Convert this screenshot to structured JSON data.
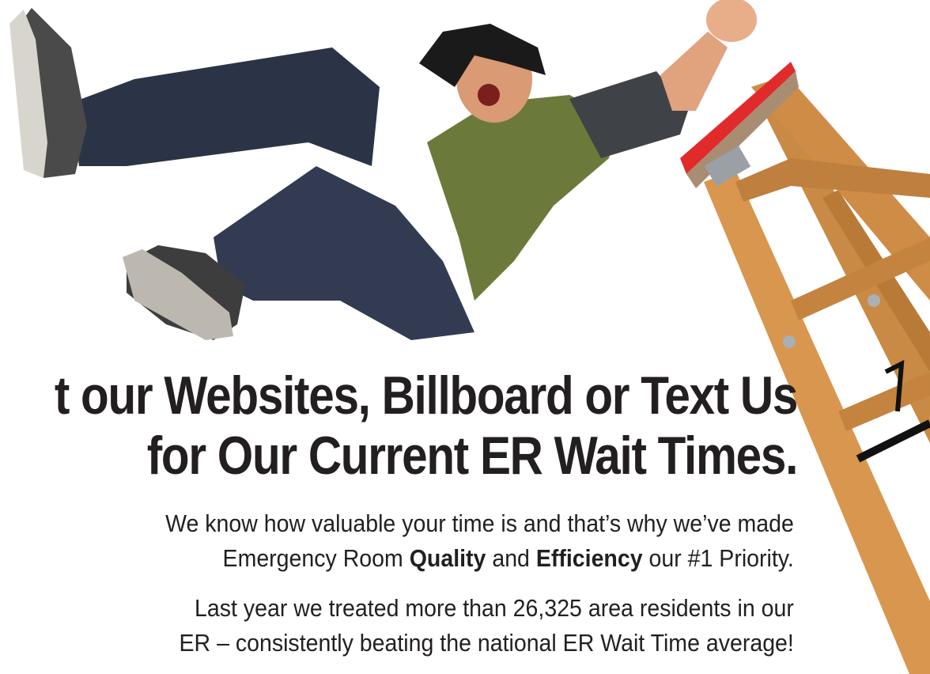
{
  "headline": {
    "line1": "t our Websites, Billboard or Text Us",
    "line2": "for Our Current ER Wait Times."
  },
  "intro": {
    "line1": "We know how valuable your time is and that’s why we’ve made",
    "line2_a": "Emergency Room ",
    "line2_quality": "Quality",
    "line2_b": " and ",
    "line2_efficiency": "Efficiency",
    "line2_c": " our #1 Priority."
  },
  "stats": {
    "line1": "Last year we treated more than 26,325 area residents in our",
    "line2": "ER – consistently beating the national ER Wait Time average!"
  },
  "colors": {
    "text": "#231f20",
    "shirt": "#6b7a3a",
    "jeans": "#2b3347",
    "ladder_wood": "#c98a45",
    "ladder_cap": "#e12b2b"
  }
}
